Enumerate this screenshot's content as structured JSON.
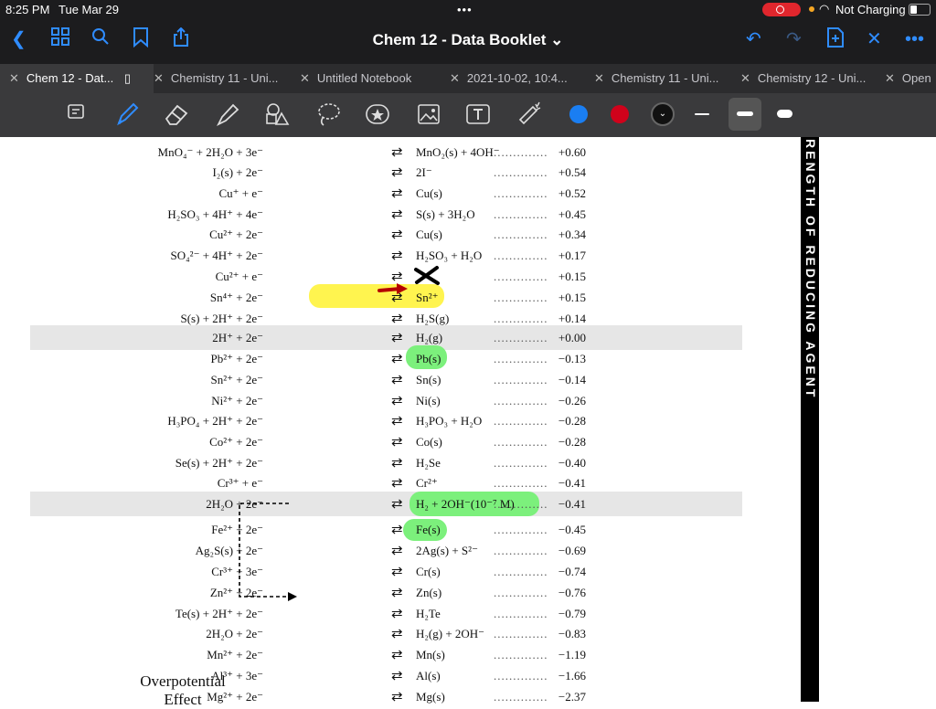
{
  "status_bar": {
    "time": "8:25 PM",
    "date": "Tue Mar 29",
    "battery_text": "Not Charging"
  },
  "document": {
    "title": "Chem 12 - Data Booklet"
  },
  "tabs": [
    {
      "label": "Chem 12 - Dat..."
    },
    {
      "label": "Chemistry 11 - Uni..."
    },
    {
      "label": "Untitled Notebook"
    },
    {
      "label": "2021-10-02, 10:4..."
    },
    {
      "label": "Chemistry 11 - Uni..."
    },
    {
      "label": "Chemistry 12 - Uni..."
    },
    {
      "label": "Open"
    }
  ],
  "toolbar": {
    "tools": [
      "lasso-select-icon",
      "pen-icon",
      "eraser-icon",
      "highlighter-icon",
      "shapes-icon",
      "lasso-icon",
      "sticker-icon",
      "image-icon",
      "text-icon",
      "laser-pointer-icon"
    ],
    "colors": [
      "#1a7ef2",
      "#d0021b",
      "#111111"
    ]
  },
  "table": {
    "rows": [
      {
        "lhs": "MnO₄⁻ + 2H₂O + 3e⁻",
        "rhs": "MnO₂(s) + 4OH⁻",
        "val": "+0.60"
      },
      {
        "lhs": "I₂(s) + 2e⁻",
        "rhs": "2I⁻",
        "val": "+0.54"
      },
      {
        "lhs": "Cu⁺ + e⁻",
        "rhs": "Cu(s)",
        "val": "+0.52"
      },
      {
        "lhs": "H₂SO₃ + 4H⁺ + 4e⁻",
        "rhs": "S(s) + 3H₂O",
        "val": "+0.45"
      },
      {
        "lhs": "Cu²⁺ + 2e⁻",
        "rhs": "Cu(s)",
        "val": "+0.34"
      },
      {
        "lhs": "SO₄²⁻ + 4H⁺ + 2e⁻",
        "rhs": "H₂SO₃ + H₂O",
        "val": "+0.17"
      },
      {
        "lhs": "Cu²⁺ + e⁻",
        "rhs": "",
        "val": "+0.15"
      },
      {
        "lhs": "Sn⁴⁺ + 2e⁻",
        "rhs": "Sn²⁺",
        "val": "+0.15"
      },
      {
        "lhs": "S(s) + 2H⁺ + 2e⁻",
        "rhs": "H₂S(g)",
        "val": "+0.14"
      },
      {
        "lhs": "2H⁺ + 2e⁻",
        "rhs": "H₂(g)",
        "val": "+0.00"
      },
      {
        "lhs": "Pb²⁺ + 2e⁻",
        "rhs": "Pb(s)",
        "val": "−0.13"
      },
      {
        "lhs": "Sn²⁺ + 2e⁻",
        "rhs": "Sn(s)",
        "val": "−0.14"
      },
      {
        "lhs": "Ni²⁺ + 2e⁻",
        "rhs": "Ni(s)",
        "val": "−0.26"
      },
      {
        "lhs": "H₃PO₄ + 2H⁺ + 2e⁻",
        "rhs": "H₃PO₃ + H₂O",
        "val": "−0.28"
      },
      {
        "lhs": "Co²⁺ + 2e⁻",
        "rhs": "Co(s)",
        "val": "−0.28"
      },
      {
        "lhs": "Se(s) + 2H⁺ + 2e⁻",
        "rhs": "H₂Se",
        "val": "−0.40"
      },
      {
        "lhs": "Cr³⁺ + e⁻",
        "rhs": "Cr²⁺",
        "val": "−0.41"
      },
      {
        "lhs": "2H₂O + 2e⁻",
        "rhs": "H₂ + 2OH⁻(10⁻⁷ M)",
        "val": "−0.41"
      },
      {
        "lhs": "Fe²⁺ + 2e⁻",
        "rhs": "Fe(s)",
        "val": "−0.45"
      },
      {
        "lhs": "Ag₂S(s) + 2e⁻",
        "rhs": "2Ag(s) + S²⁻",
        "val": "−0.69"
      },
      {
        "lhs": "Cr³⁺ + 3e⁻",
        "rhs": "Cr(s)",
        "val": "−0.74"
      },
      {
        "lhs": "Zn²⁺ + 2e⁻",
        "rhs": "Zn(s)",
        "val": "−0.76"
      },
      {
        "lhs": "Te(s) + 2H⁺ + 2e⁻",
        "rhs": "H₂Te",
        "val": "−0.79"
      },
      {
        "lhs": "2H₂O + 2e⁻",
        "rhs": "H₂(g) + 2OH⁻",
        "val": "−0.83"
      },
      {
        "lhs": "Mn²⁺ + 2e⁻",
        "rhs": "Mn(s)",
        "val": "−1.19"
      },
      {
        "lhs": "Al³⁺ + 3e⁻",
        "rhs": "Al(s)",
        "val": "−1.66"
      },
      {
        "lhs": "Mg²⁺ + 2e⁻",
        "rhs": "Mg(s)",
        "val": "−2.37"
      }
    ]
  },
  "annotations": {
    "overpotential_line1": "Overpotential",
    "overpotential_line2": "Effect"
  },
  "sidebar": {
    "text": "RENGTH OF REDUCING AGENT"
  }
}
